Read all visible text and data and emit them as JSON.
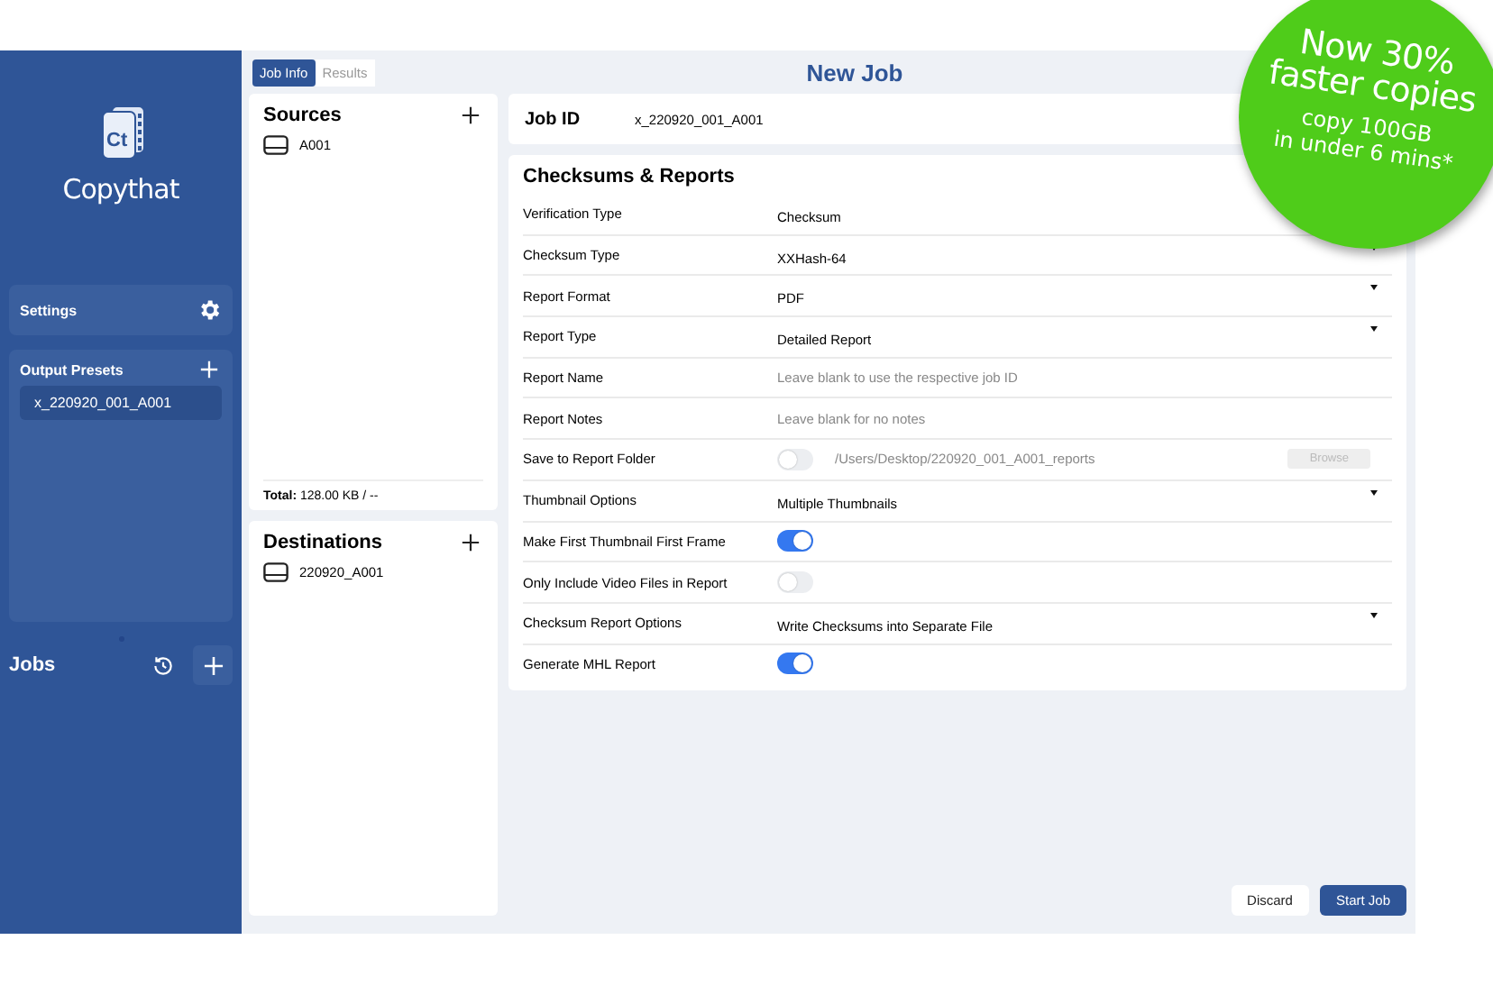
{
  "sidebar": {
    "logo": {
      "icon_text": "Ct",
      "name": "Copythat"
    },
    "settings": {
      "label": "Settings"
    },
    "output_presets": {
      "title": "Output Presets",
      "items": [
        {
          "label": "x_220920_001_A001",
          "selected": true
        }
      ]
    },
    "jobs": {
      "title": "Jobs"
    }
  },
  "tabs": [
    {
      "label": "Job Info",
      "selected": true
    },
    {
      "label": "Results",
      "selected": false
    }
  ],
  "title": "New Job",
  "sources": {
    "title": "Sources",
    "items": [
      {
        "label": "A001"
      }
    ],
    "total_label": "Total:",
    "total_value": "128.00 KB / --"
  },
  "destinations": {
    "title": "Destinations",
    "items": [
      {
        "label": "220920_A001"
      }
    ]
  },
  "job_id": {
    "label": "Job ID",
    "value": "x_220920_001_A001"
  },
  "checksums": {
    "title": "Checksums & Reports",
    "rows": [
      {
        "label": "Verification Type",
        "kind": "select",
        "value": "Checksum"
      },
      {
        "label": "Checksum Type",
        "kind": "select",
        "value": "XXHash-64",
        "caret": true
      },
      {
        "label": "Report Format",
        "kind": "select",
        "value": "PDF",
        "caret": true
      },
      {
        "label": "Report Type",
        "kind": "select",
        "value": "Detailed Report",
        "caret": true
      },
      {
        "label": "Report Name",
        "kind": "text",
        "placeholder": "Leave blank to use the respective job ID"
      },
      {
        "label": "Report Notes",
        "kind": "text",
        "placeholder": "Leave blank for no notes"
      },
      {
        "label": "Save to Report Folder",
        "kind": "folder",
        "on": false,
        "path": "/Users/Desktop/220920_001_A001_reports",
        "button": "Browse",
        "disabled": true
      },
      {
        "label": "Thumbnail Options",
        "kind": "select",
        "value": "Multiple Thumbnails",
        "caret": true
      },
      {
        "label": "Make First Thumbnail First Frame",
        "kind": "toggle",
        "on": true
      },
      {
        "label": "Only Include Video Files in Report",
        "kind": "toggle",
        "on": false
      },
      {
        "label": "Checksum Report Options",
        "kind": "select",
        "value": "Write Checksums into Separate File",
        "caret": true
      },
      {
        "label": "Generate MHL Report",
        "kind": "toggle",
        "on": true
      }
    ]
  },
  "buttons": [
    {
      "label": "Discard",
      "kind": "secondary"
    },
    {
      "label": "Start Job",
      "kind": "primary"
    }
  ],
  "promo": {
    "headline_1": "Now 30%",
    "headline_2": "faster copies",
    "line_1": "copy 100GB",
    "line_2": "in under 6 mins*"
  }
}
